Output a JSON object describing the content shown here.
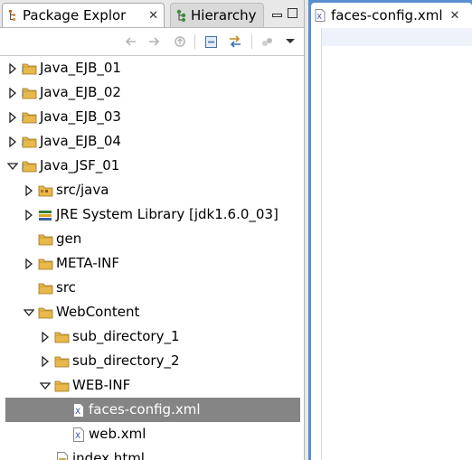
{
  "left_view": {
    "active_tab": {
      "label": "Package Explor",
      "icon": "package-explorer-icon"
    },
    "inactive_tab": {
      "label": "Hierarchy",
      "icon": "hierarchy-icon"
    },
    "toolbar": [
      "back-icon",
      "forward-icon",
      "up-icon",
      "collapse-all-icon",
      "link-with-editor-icon",
      "filter-icon",
      "view-menu-icon"
    ]
  },
  "tree": {
    "items": [
      {
        "label": "Java_EJB_01",
        "depth": 0,
        "state": "collapsed",
        "icon": "project-icon"
      },
      {
        "label": "Java_EJB_02",
        "depth": 0,
        "state": "collapsed",
        "icon": "project-icon"
      },
      {
        "label": "Java_EJB_03",
        "depth": 0,
        "state": "collapsed",
        "icon": "project-icon"
      },
      {
        "label": "Java_EJB_04",
        "depth": 0,
        "state": "collapsed",
        "icon": "project-icon"
      },
      {
        "label": "Java_JSF_01",
        "depth": 0,
        "state": "expanded",
        "icon": "project-icon"
      },
      {
        "label": "src/java",
        "depth": 1,
        "state": "collapsed",
        "icon": "source-folder-icon"
      },
      {
        "label": "JRE System Library [jdk1.6.0_03]",
        "depth": 1,
        "state": "collapsed",
        "icon": "library-icon"
      },
      {
        "label": "gen",
        "depth": 1,
        "state": "none",
        "icon": "folder-icon"
      },
      {
        "label": "META-INF",
        "depth": 1,
        "state": "collapsed",
        "icon": "folder-icon"
      },
      {
        "label": "src",
        "depth": 1,
        "state": "none",
        "icon": "folder-icon"
      },
      {
        "label": "WebContent",
        "depth": 1,
        "state": "expanded",
        "icon": "folder-icon"
      },
      {
        "label": "sub_directory_1",
        "depth": 2,
        "state": "collapsed",
        "icon": "folder-icon"
      },
      {
        "label": "sub_directory_2",
        "depth": 2,
        "state": "collapsed",
        "icon": "folder-icon"
      },
      {
        "label": "WEB-INF",
        "depth": 2,
        "state": "expanded",
        "icon": "folder-icon"
      },
      {
        "label": "faces-config.xml",
        "depth": 3,
        "state": "none",
        "icon": "xml-file-icon",
        "selected": true
      },
      {
        "label": "web.xml",
        "depth": 3,
        "state": "none",
        "icon": "xml-file-icon"
      },
      {
        "label": "index.html",
        "depth": 2,
        "state": "none",
        "icon": "html-file-icon"
      }
    ]
  },
  "editor": {
    "tab_label": "faces-config.xml",
    "tab_icon": "xml-file-icon"
  },
  "colors": {
    "selection": "#858585",
    "accent": "#5a8fd0",
    "folder": "#e8b84a"
  }
}
